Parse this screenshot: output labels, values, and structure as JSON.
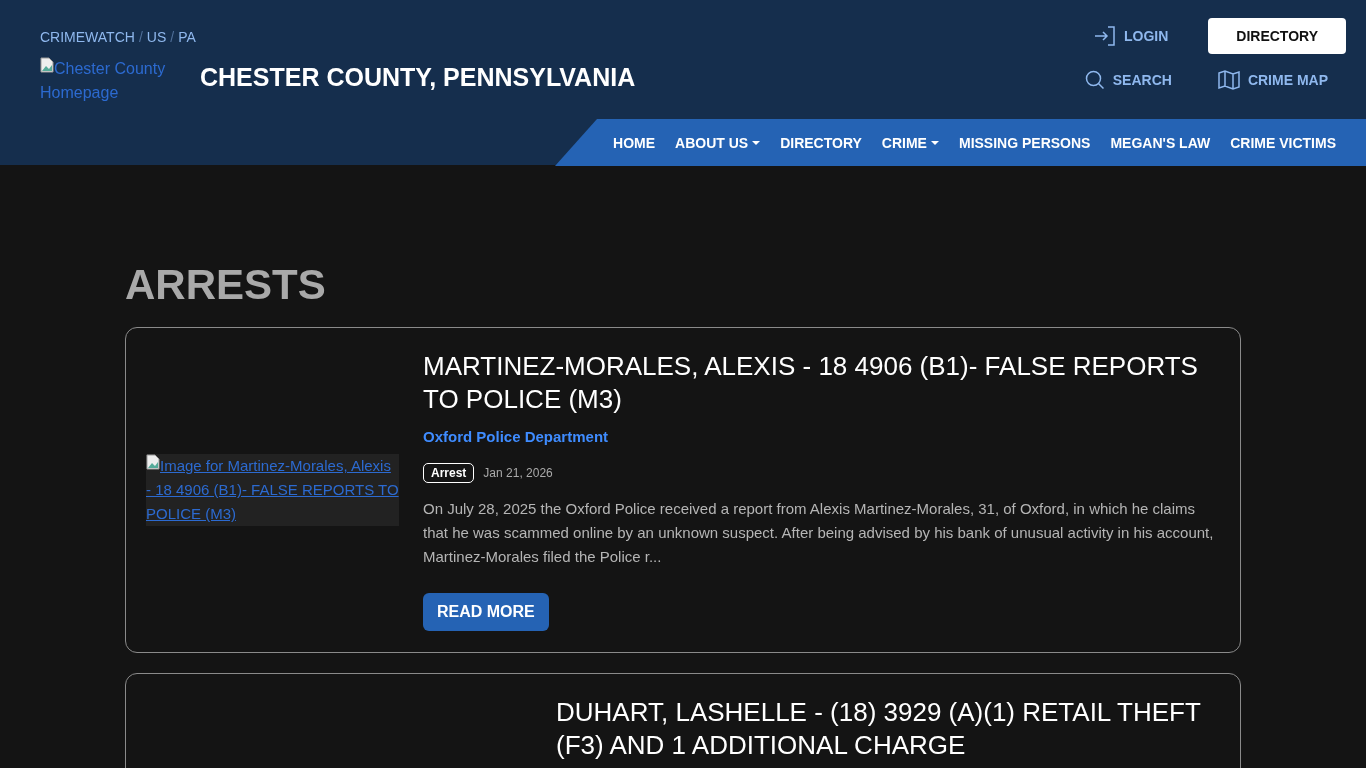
{
  "breadcrumb": [
    "CRIMEWATCH",
    "US",
    "PA"
  ],
  "breadcrumb_separator": "/",
  "logo": {
    "alt": "Chester County Homepage"
  },
  "site_title": "CHESTER COUNTY, PENNSYLVANIA",
  "top_actions": [
    {
      "label": "LOGIN",
      "kind": "login"
    },
    {
      "label": "DIRECTORY",
      "kind": "button"
    }
  ],
  "tools": [
    {
      "label": "SEARCH",
      "kind": "search"
    },
    {
      "label": "CRIME MAP",
      "kind": "map"
    }
  ],
  "nav": [
    {
      "label": "HOME",
      "dropdown": false
    },
    {
      "label": "ABOUT US",
      "dropdown": true
    },
    {
      "label": "DIRECTORY",
      "dropdown": false
    },
    {
      "label": "CRIME",
      "dropdown": true
    },
    {
      "label": "MISSING PERSONS",
      "dropdown": false
    },
    {
      "label": "MEGAN'S LAW",
      "dropdown": false
    },
    {
      "label": "CRIME VICTIMS",
      "dropdown": false
    }
  ],
  "page_title": "ARRESTS",
  "articles": [
    {
      "image_alt": "Image for Martinez-Morales, Alexis - 18 4906 (B1)- FALSE REPORTS TO POLICE (M3)",
      "title": "MARTINEZ-MORALES, ALEXIS - 18 4906 (B1)- FALSE REPORTS TO POLICE (M3)",
      "agency": "Oxford Police Department",
      "tag": "Arrest",
      "date": "Jan 21, 2026",
      "summary": "On July 28, 2025 the Oxford Police received a report from Alexis Martinez-Morales, 31, of Oxford, in which he claims that he was scammed online by an unknown suspect.   After being advised by his bank of unusual activity in his account, Martinez-Morales filed the Police r...",
      "button": "READ MORE"
    },
    {
      "title": "DUHART, LASHELLE - (18) 3929 (A)(1) RETAIL THEFT (F3) AND 1 ADDITIONAL CHARGE"
    }
  ]
}
